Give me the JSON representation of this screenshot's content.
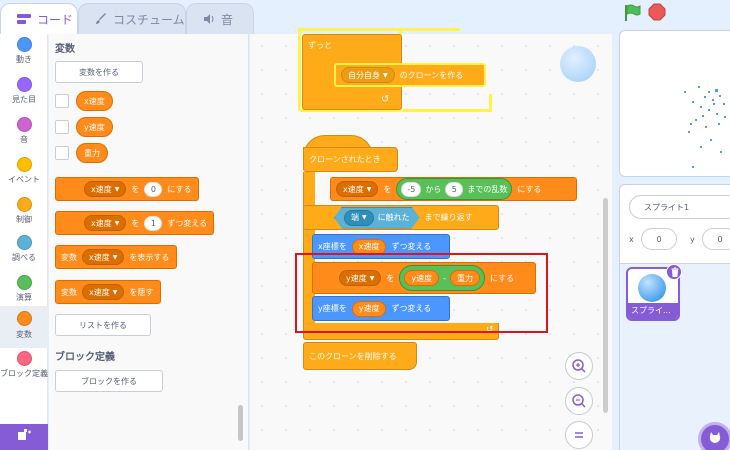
{
  "tabs": {
    "code": "コード",
    "costume": "コスチューム",
    "sound": "音"
  },
  "categories": [
    {
      "label": "動き",
      "color": "#4c97ff"
    },
    {
      "label": "見た目",
      "color": "#9966ff"
    },
    {
      "label": "音",
      "color": "#cf63cf"
    },
    {
      "label": "イベント",
      "color": "#ffbf00"
    },
    {
      "label": "制御",
      "color": "#ffab19"
    },
    {
      "label": "調べる",
      "color": "#5cb1d6"
    },
    {
      "label": "演算",
      "color": "#59c059"
    },
    {
      "label": "変数",
      "color": "#ff8c1a"
    },
    {
      "label": "ブロック定義",
      "color": "#ff6680"
    }
  ],
  "palette": {
    "heading": "変数",
    "make_var": "変数を作る",
    "vars": [
      "x速度",
      "y速度",
      "重力"
    ],
    "blk_set": {
      "var": "x速度",
      "kw": "を",
      "val": "0",
      "tail": "にする"
    },
    "blk_change": {
      "var": "x速度",
      "kw": "を",
      "val": "1",
      "tail": "ずつ変える"
    },
    "blk_show": {
      "pre": "変数",
      "var": "x速度",
      "tail": "を表示する"
    },
    "blk_hide": {
      "pre": "変数",
      "var": "x速度",
      "tail": "を隠す"
    },
    "make_list": "リストを作る",
    "myblocks_heading": "ブロック定義",
    "make_block": "ブロックを作る"
  },
  "script1": {
    "forever": "ずっと",
    "clone_target": "自分自身",
    "clone_tail": "のクローンを作る"
  },
  "script2": {
    "hat": "クローンされたとき",
    "set_var": "x速度",
    "set_kw": "を",
    "rand_from": "-5",
    "rand_mid": "から",
    "rand_to": "5",
    "rand_tail": "までの乱数",
    "set_tail": "にする",
    "edge": "端",
    "touching": "に触れた",
    "repeat_until": "まで繰り返す",
    "change_x_pre": "x座標を",
    "change_x_var": "x速度",
    "change_x_tail": "ずつ変える",
    "set_y_var": "y速度",
    "set_y_kw": "を",
    "sub_a": "y速度",
    "sub_op": "-",
    "sub_b": "重力",
    "set_y_tail": "にする",
    "change_y_pre": "y座標を",
    "change_y_var": "y速度",
    "change_y_tail": "ずつ変える",
    "delete_clone": "このクローンを削除する"
  },
  "sprite_info": {
    "name": "スプライト1",
    "x_label": "x",
    "x_val": "0",
    "y_label": "y",
    "y_val": "0"
  },
  "sprite_list": {
    "thumb_label": "スプライ..."
  }
}
